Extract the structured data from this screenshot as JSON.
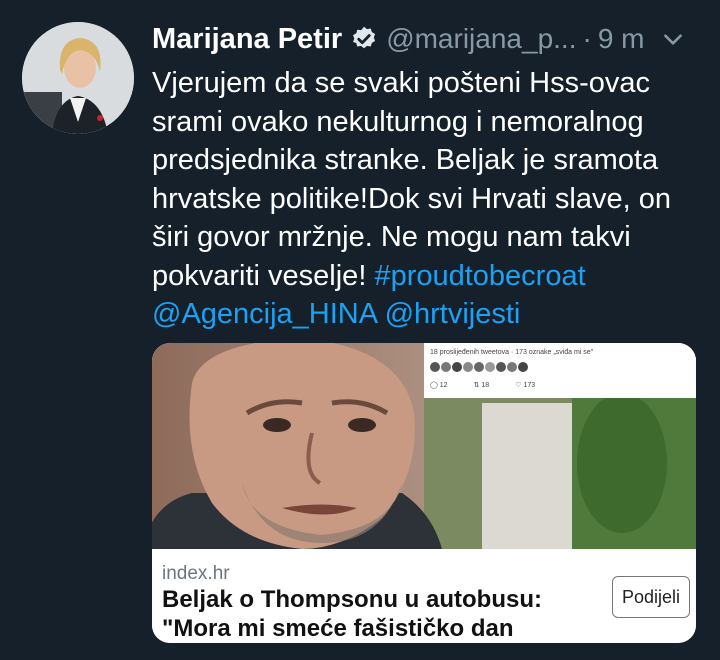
{
  "tweet": {
    "author_name": "Marijana Petir",
    "handle": "@marijana_p...",
    "separator": "·",
    "time": "9 m",
    "text_before": "Vjerujem da se svaki pošteni Hss-ovac srami ovako nekulturnog i nemoralnog predsjednika stranke. Beljak je sramota hrvatske politike!Dok svi Hrvati slave, on širi govor mržnje. Ne mogu nam takvi pokvariti veselje! ",
    "hashtag": "#proudtobecroat",
    "mention1": "@Agencija_HINA",
    "mention2": "@hrtvijesti",
    "icons": [
      "avatar",
      "verified-badge-icon",
      "chevron-down-icon"
    ]
  },
  "card": {
    "domain": "index.hr",
    "headline": "Beljak o Thompsonu u autobusu: \"Mora mi smeće fašističko dan pokvarit\"",
    "share_label": "Podijeli",
    "mini": {
      "counts_text": "18 proslijeđenih tweetova · 173 oznake „sviđa mi se\"",
      "reply": "12",
      "retweet": "18",
      "like": "173"
    }
  },
  "colors": {
    "background": "#15202b",
    "text": "#ffffff",
    "secondary": "#8899a6",
    "link": "#1da1f2"
  }
}
